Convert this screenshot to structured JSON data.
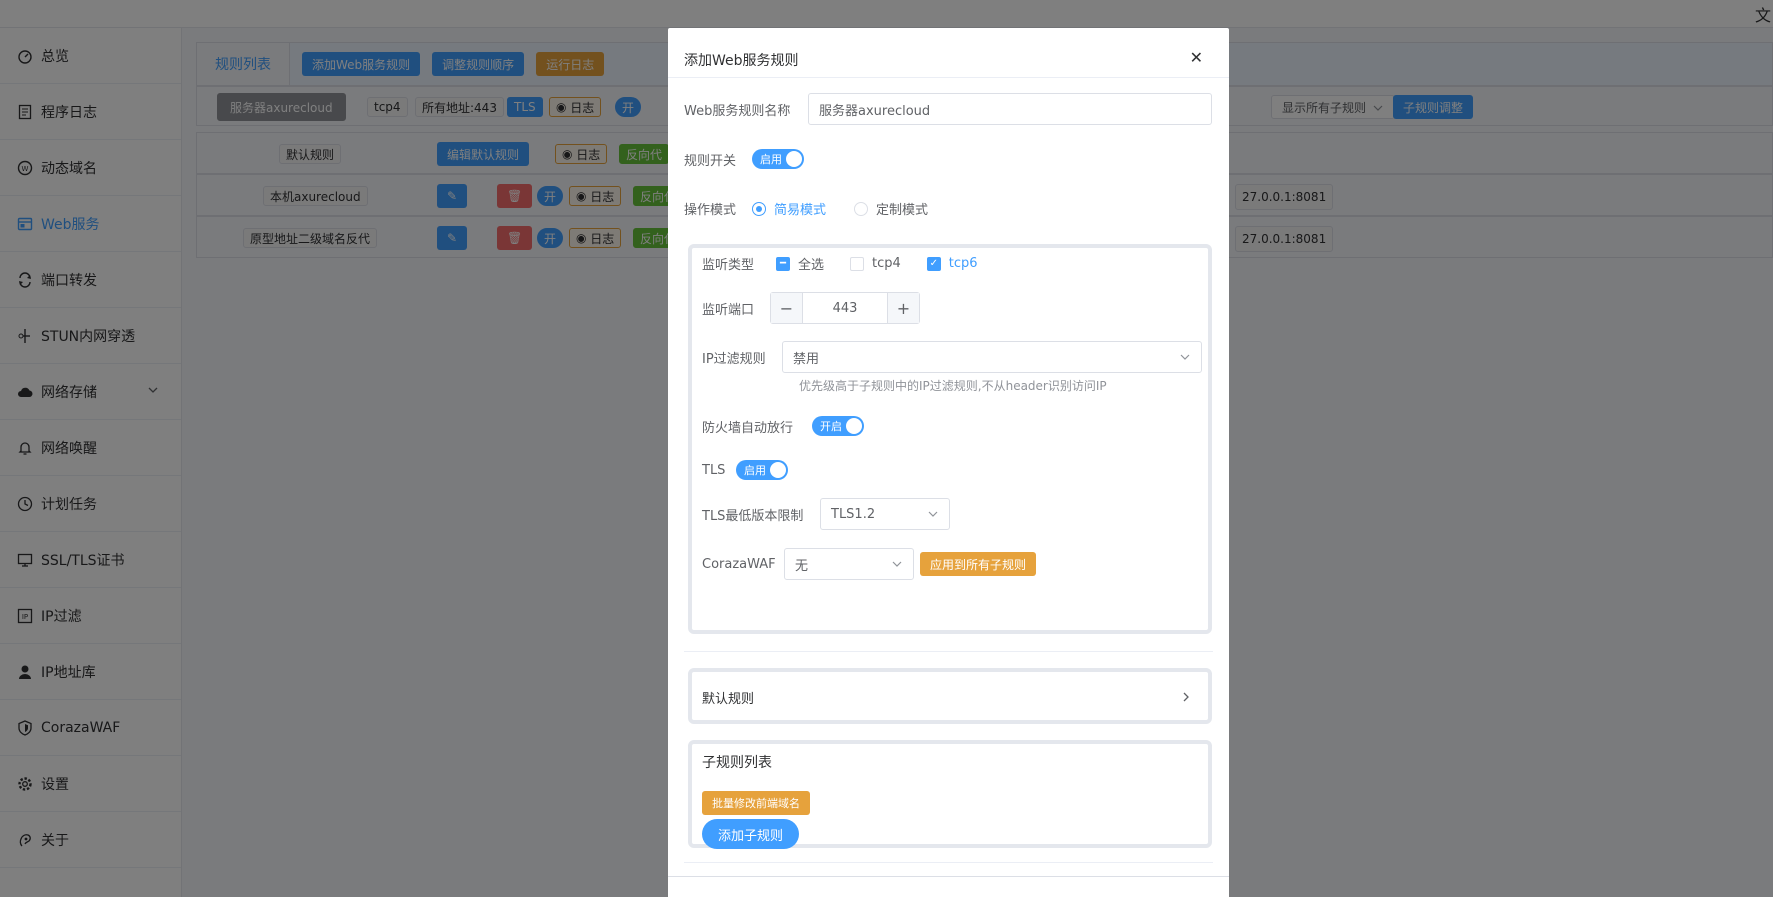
{
  "topbar": {
    "corner_text": "文"
  },
  "sidebar": {
    "items": [
      {
        "label": "总览",
        "icon": "dashboard-icon"
      },
      {
        "label": "程序日志",
        "icon": "log-icon"
      },
      {
        "label": "动态域名",
        "icon": "ddns-icon"
      },
      {
        "label": "Web服务",
        "icon": "web-icon",
        "active": true
      },
      {
        "label": "端口转发",
        "icon": "port-forward-icon"
      },
      {
        "label": "STUN内网穿透",
        "icon": "stun-icon"
      },
      {
        "label": "网络存储",
        "icon": "cloud-storage-icon",
        "has_submenu": true
      },
      {
        "label": "网络唤醒",
        "icon": "bell-icon"
      },
      {
        "label": "计划任务",
        "icon": "clock-icon"
      },
      {
        "label": "SSL/TLS证书",
        "icon": "certificate-icon"
      },
      {
        "label": "IP过滤",
        "icon": "ip-filter-icon"
      },
      {
        "label": "IP地址库",
        "icon": "ip-database-icon"
      },
      {
        "label": "CorazaWAF",
        "icon": "shield-icon"
      },
      {
        "label": "设置",
        "icon": "gear-icon"
      },
      {
        "label": "关于",
        "icon": "about-icon"
      }
    ]
  },
  "main": {
    "tab_label": "规则列表",
    "toolbar": {
      "add_rule": "添加Web服务规则",
      "adjust_order": "调整规则顺序",
      "run_log": "运行日志"
    },
    "server_rule": {
      "name": "服务器axurecloud",
      "tags": [
        "tcp4",
        "所有地址:443",
        "TLS"
      ],
      "log": "日志",
      "switch_label": "开",
      "filter_select": "显示所有子规则",
      "adjust_sub": "子规则调整"
    },
    "rows": [
      {
        "name": "默认规则",
        "edit": "编辑默认规则",
        "log": "日志",
        "proxy": "反向代"
      },
      {
        "name": "本机axurecloud",
        "switch": "开",
        "log": "日志",
        "proxy": "反向代",
        "target": "27.0.0.1:8081"
      },
      {
        "name": "原型地址二级域名反代",
        "switch": "开",
        "log": "日志",
        "proxy": "反向代",
        "target": "27.0.0.1:8081"
      }
    ]
  },
  "dialog": {
    "title": "添加Web服务规则",
    "rule_name_label": "Web服务规则名称",
    "rule_name_value": "服务器axurecloud",
    "rule_switch_label": "规则开关",
    "rule_switch_text": "启用",
    "mode_label": "操作模式",
    "mode_simple": "简易模式",
    "mode_custom": "定制模式",
    "listen_type_label": "监听类型",
    "listen_all": "全选",
    "listen_tcp4": "tcp4",
    "listen_tcp6": "tcp6",
    "listen_port_label": "监听端口",
    "listen_port_value": "443",
    "ip_filter_label": "IP过滤规则",
    "ip_filter_value": "禁用",
    "ip_filter_hint": "优先级高于子规则中的IP过滤规则,不从header识别访问IP",
    "firewall_label": "防火墙自动放行",
    "firewall_switch": "开启",
    "tls_label": "TLS",
    "tls_switch": "启用",
    "tls_min_label": "TLS最低版本限制",
    "tls_min_value": "TLS1.2",
    "waf_label": "CorazaWAF",
    "waf_value": "无",
    "waf_apply": "应用到所有子规则",
    "default_rule_label": "默认规则",
    "sub_rules_title": "子规则列表",
    "batch_edit": "批量修改前端域名",
    "add_sub_rule": "添加子规则"
  }
}
